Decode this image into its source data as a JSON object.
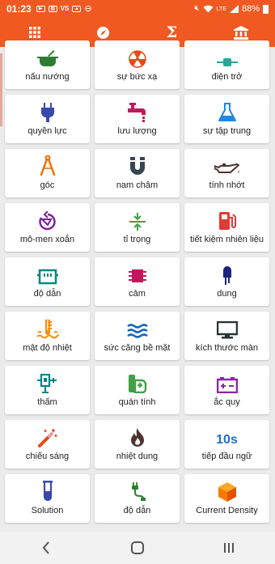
{
  "status_bar": {
    "time": "01:23",
    "battery": "88%",
    "left_icons": [
      "youtube-icon",
      "gallery-icon",
      "vtv-icon",
      "image-icon",
      "dnd-icon"
    ],
    "right_icons": [
      "mute-icon",
      "wifi-icon",
      "lte-icon",
      "signal-icon",
      "battery-icon"
    ]
  },
  "top_tabs": [
    {
      "name": "grid-tab",
      "icon": "grid-icon",
      "active": true
    },
    {
      "name": "compass-tab",
      "icon": "compass-icon",
      "active": false
    },
    {
      "name": "sigma-tab",
      "icon": "sigma-icon",
      "glyph": "Σ",
      "active": false
    },
    {
      "name": "bank-tab",
      "icon": "bank-icon",
      "active": false
    }
  ],
  "items": [
    {
      "label": "nấu nướng",
      "icon": "cooking-pot-icon",
      "color": "#2e7d32"
    },
    {
      "label": "sự bức xạ",
      "icon": "radiation-icon",
      "color": "#e64a19"
    },
    {
      "label": "điện trở",
      "icon": "resistor-icon",
      "color": "#26a69a"
    },
    {
      "label": "quyền lực",
      "icon": "power-plug-icon",
      "color": "#3949ab"
    },
    {
      "label": "lưu lượng",
      "icon": "faucet-icon",
      "color": "#c2185b"
    },
    {
      "label": "sự tập trung",
      "icon": "flask-icon",
      "color": "#1e88e5"
    },
    {
      "label": "góc",
      "icon": "compass-drafting-icon",
      "color": "#ef6c00"
    },
    {
      "label": "nam châm",
      "icon": "magnet-icon",
      "color": "#37474f"
    },
    {
      "label": "tính nhớt",
      "icon": "oil-can-icon",
      "color": "#4e342e"
    },
    {
      "label": "mô-men xoắn",
      "icon": "torque-icon",
      "color": "#7b1fa2"
    },
    {
      "label": "tỉ trọng",
      "icon": "density-arrows-icon",
      "color": "#43a047"
    },
    {
      "label": "tiết kiệm nhiên liệu",
      "icon": "fuel-pump-icon",
      "color": "#e53935"
    },
    {
      "label": "độ dẫn",
      "icon": "connector-icon",
      "color": "#00897b"
    },
    {
      "label": "cảm",
      "icon": "chip-icon",
      "color": "#c2185b"
    },
    {
      "label": "dung",
      "icon": "capacitor-icon",
      "color": "#1a237e"
    },
    {
      "label": "mật độ nhiệt",
      "icon": "heat-thermometer-icon",
      "color": "#fb8c00"
    },
    {
      "label": "sức căng bề mặt",
      "icon": "waves-icon",
      "color": "#1565c0"
    },
    {
      "label": "kích thước màn",
      "icon": "monitor-icon",
      "color": "#263238"
    },
    {
      "label": "thấm",
      "icon": "permeability-icon",
      "color": "#00838f"
    },
    {
      "label": "quán tính",
      "icon": "inertia-icon",
      "color": "#43a047"
    },
    {
      "label": "ắc quy",
      "icon": "battery-icon",
      "color": "#8e24aa"
    },
    {
      "label": "chiếu sáng",
      "icon": "magic-wand-icon",
      "color": "#e64a19"
    },
    {
      "label": "nhiệt dung",
      "icon": "flame-icon",
      "color": "#4e342e"
    },
    {
      "label": "tiếp đầu ngữ",
      "icon": "ten-s-icon",
      "text_icon": "10s",
      "color": "#1e6fd0"
    },
    {
      "label": "Solution",
      "icon": "test-tube-icon",
      "color": "#3949ab"
    },
    {
      "label": "độ dẫn",
      "icon": "cable-icon",
      "color": "#2e7d32"
    },
    {
      "label": "Current Density",
      "icon": "cube-icon",
      "color": "#f57c00"
    }
  ],
  "nav": [
    {
      "name": "nav-back-button",
      "icon": "chevron-left-icon"
    },
    {
      "name": "nav-home-button",
      "icon": "home-square-icon"
    },
    {
      "name": "nav-recents-button",
      "icon": "recents-icon"
    }
  ]
}
